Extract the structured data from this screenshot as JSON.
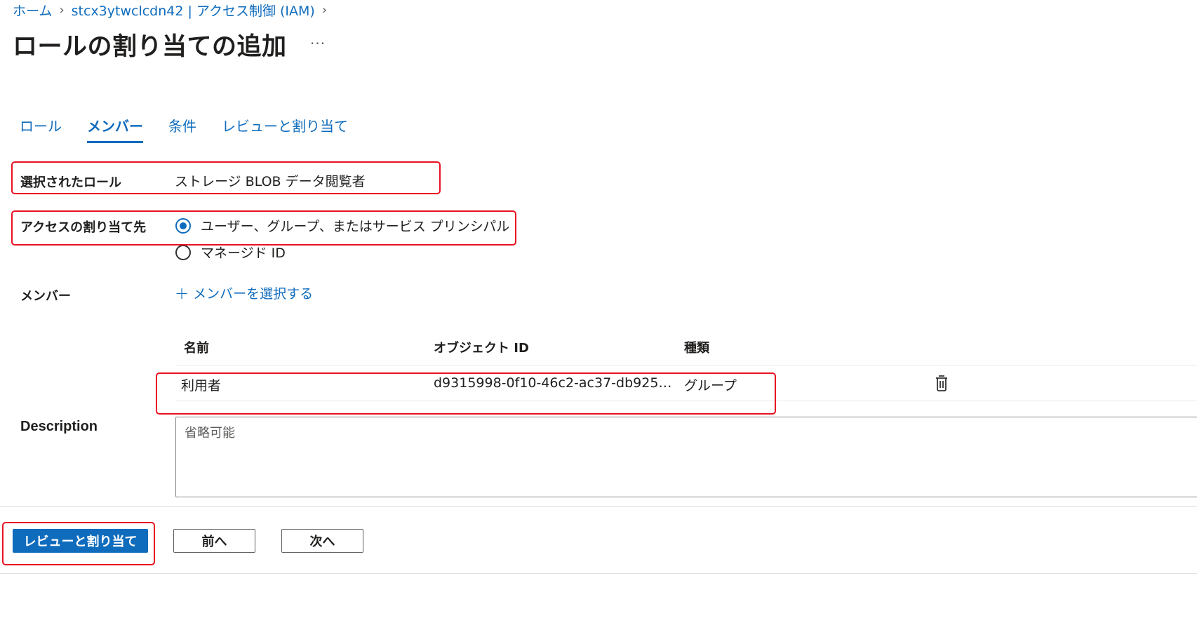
{
  "breadcrumb": {
    "home": "ホーム",
    "resource": "stcx3ytwclcdn42 | アクセス制御 (IAM)"
  },
  "page_title": "ロールの割り当ての追加",
  "more_label": "···",
  "tabs": [
    {
      "label": "ロール",
      "active": false
    },
    {
      "label": "メンバー",
      "active": true
    },
    {
      "label": "条件",
      "active": false
    },
    {
      "label": "レビューと割り当て",
      "active": false
    }
  ],
  "selected_role": {
    "label": "選択されたロール",
    "value": "ストレージ BLOB データ閲覧者"
  },
  "assign_access": {
    "label": "アクセスの割り当て先",
    "options": [
      {
        "label": "ユーザー、グループ、またはサービス プリンシパル",
        "checked": true
      },
      {
        "label": "マネージド ID",
        "checked": false
      }
    ]
  },
  "members": {
    "label": "メンバー",
    "add_label": "メンバーを選択する",
    "columns": [
      "名前",
      "オブジェクト ID",
      "種類"
    ],
    "rows": [
      {
        "name": "利用者",
        "object_id": "d9315998-0f10-46c2-ac37-db925…",
        "type": "グループ"
      }
    ]
  },
  "description": {
    "label": "Description",
    "placeholder": "省略可能"
  },
  "footer": {
    "review_assign": "レビューと割り当て",
    "previous": "前へ",
    "next": "次へ"
  },
  "colors": {
    "accent": "#0f6cbd",
    "highlight": "#e81123"
  }
}
